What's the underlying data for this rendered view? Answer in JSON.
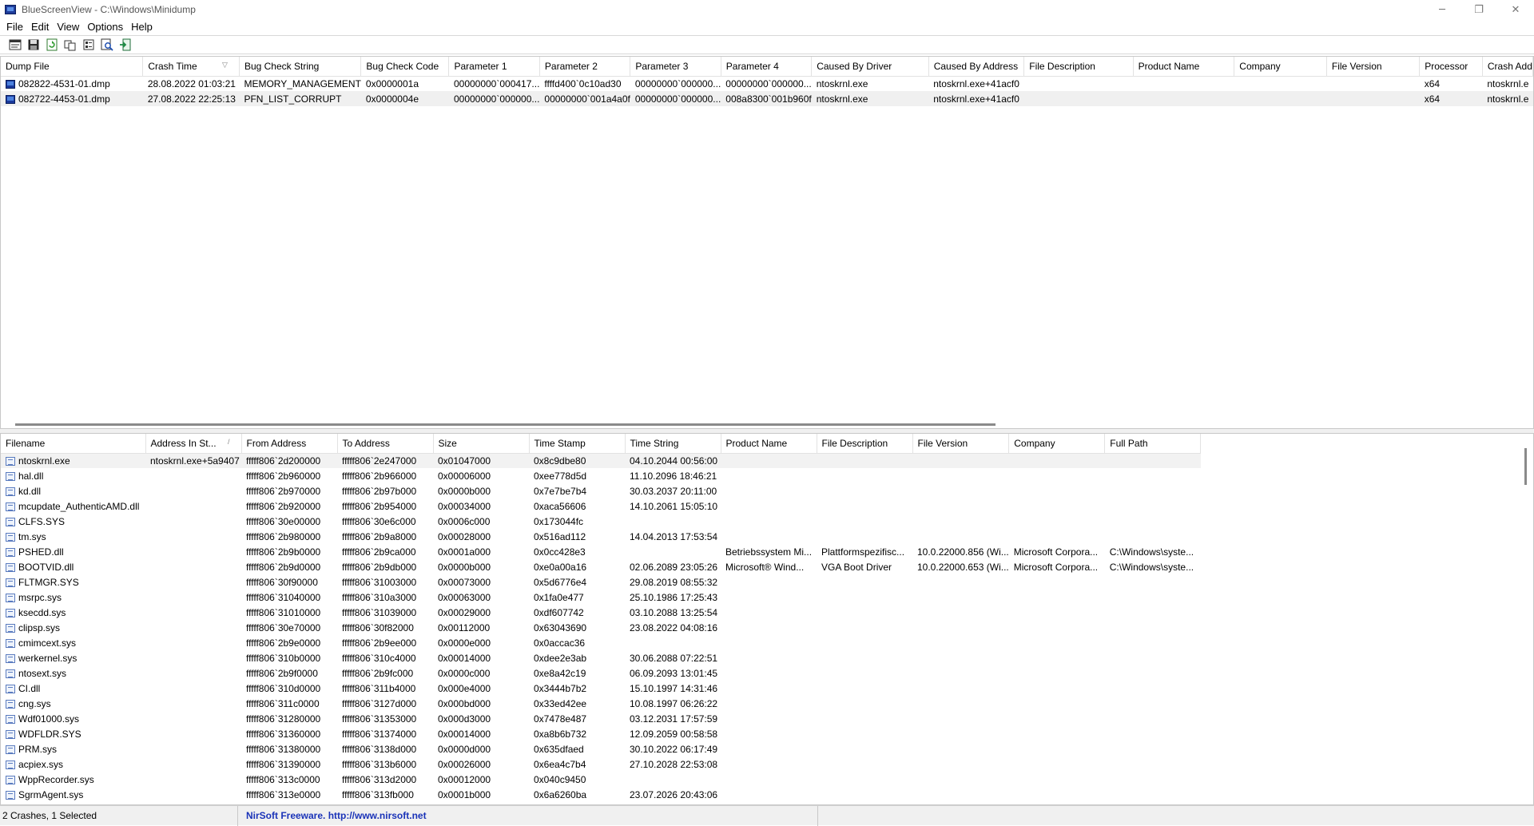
{
  "window": {
    "title": "BlueScreenView  -  C:\\Windows\\Minidump",
    "minimize_glyph": "─",
    "restore_glyph": "❐",
    "close_glyph": "✕"
  },
  "menu": [
    "File",
    "Edit",
    "View",
    "Options",
    "Help"
  ],
  "toolbar_icons": [
    "html-report-icon",
    "save-icon",
    "refresh-icon",
    "copy-icon",
    "properties-icon",
    "find-icon",
    "exit-icon"
  ],
  "crashes": {
    "columns": [
      {
        "label": "Dump File",
        "sort": ""
      },
      {
        "label": "Crash Time",
        "sort": "▽"
      },
      {
        "label": "Bug Check String",
        "sort": ""
      },
      {
        "label": "Bug Check Code",
        "sort": ""
      },
      {
        "label": "Parameter 1",
        "sort": ""
      },
      {
        "label": "Parameter 2",
        "sort": ""
      },
      {
        "label": "Parameter 3",
        "sort": ""
      },
      {
        "label": "Parameter 4",
        "sort": ""
      },
      {
        "label": "Caused By Driver",
        "sort": ""
      },
      {
        "label": "Caused By Address",
        "sort": ""
      },
      {
        "label": "File Description",
        "sort": ""
      },
      {
        "label": "Product Name",
        "sort": ""
      },
      {
        "label": "Company",
        "sort": ""
      },
      {
        "label": "File Version",
        "sort": ""
      },
      {
        "label": "Processor",
        "sort": ""
      },
      {
        "label": "Crash Add",
        "sort": ""
      }
    ],
    "rows": [
      [
        "082822-4531-01.dmp",
        "28.08.2022 01:03:21",
        "MEMORY_MANAGEMENT",
        "0x0000001a",
        "00000000`000417...",
        "ffffd400`0c10ad30",
        "00000000`000000...",
        "00000000`000000...",
        "ntoskrnl.exe",
        "ntoskrnl.exe+41acf0",
        "",
        "",
        "",
        "",
        "x64",
        "ntoskrnl.e"
      ],
      [
        "082722-4453-01.dmp",
        "27.08.2022 22:25:13",
        "PFN_LIST_CORRUPT",
        "0x0000004e",
        "00000000`000000...",
        "00000000`001a4a0f",
        "00000000`000000...",
        "008a8300`001b960f",
        "ntoskrnl.exe",
        "ntoskrnl.exe+41acf0",
        "",
        "",
        "",
        "",
        "x64",
        "ntoskrnl.e"
      ]
    ],
    "selected_index": 1
  },
  "modules": {
    "columns": [
      {
        "label": "Filename",
        "sort": ""
      },
      {
        "label": "Address In St...",
        "sort": "/"
      },
      {
        "label": "From Address",
        "sort": ""
      },
      {
        "label": "To Address",
        "sort": ""
      },
      {
        "label": "Size",
        "sort": ""
      },
      {
        "label": "Time Stamp",
        "sort": ""
      },
      {
        "label": "Time String",
        "sort": ""
      },
      {
        "label": "Product Name",
        "sort": ""
      },
      {
        "label": "File Description",
        "sort": ""
      },
      {
        "label": "File Version",
        "sort": ""
      },
      {
        "label": "Company",
        "sort": ""
      },
      {
        "label": "Full Path",
        "sort": ""
      }
    ],
    "rows": [
      [
        "ntoskrnl.exe",
        "ntoskrnl.exe+5a9407",
        "fffff806`2d200000",
        "fffff806`2e247000",
        "0x01047000",
        "0x8c9dbe80",
        "04.10.2044 00:56:00",
        "",
        "",
        "",
        "",
        ""
      ],
      [
        "hal.dll",
        "",
        "fffff806`2b960000",
        "fffff806`2b966000",
        "0x00006000",
        "0xee778d5d",
        "11.10.2096 18:46:21",
        "",
        "",
        "",
        "",
        ""
      ],
      [
        "kd.dll",
        "",
        "fffff806`2b970000",
        "fffff806`2b97b000",
        "0x0000b000",
        "0x7e7be7b4",
        "30.03.2037 20:11:00",
        "",
        "",
        "",
        "",
        ""
      ],
      [
        "mcupdate_AuthenticAMD.dll",
        "",
        "fffff806`2b920000",
        "fffff806`2b954000",
        "0x00034000",
        "0xaca56606",
        "14.10.2061 15:05:10",
        "",
        "",
        "",
        "",
        ""
      ],
      [
        "CLFS.SYS",
        "",
        "fffff806`30e00000",
        "fffff806`30e6c000",
        "0x0006c000",
        "0x173044fc",
        "",
        "",
        "",
        "",
        "",
        ""
      ],
      [
        "tm.sys",
        "",
        "fffff806`2b980000",
        "fffff806`2b9a8000",
        "0x00028000",
        "0x516ad112",
        "14.04.2013 17:53:54",
        "",
        "",
        "",
        "",
        ""
      ],
      [
        "PSHED.dll",
        "",
        "fffff806`2b9b0000",
        "fffff806`2b9ca000",
        "0x0001a000",
        "0x0cc428e3",
        "",
        "Betriebssystem Mi...",
        "Plattformspezifisc...",
        "10.0.22000.856 (Wi...",
        "Microsoft Corpora...",
        "C:\\Windows\\syste..."
      ],
      [
        "BOOTVID.dll",
        "",
        "fffff806`2b9d0000",
        "fffff806`2b9db000",
        "0x0000b000",
        "0xe0a00a16",
        "02.06.2089 23:05:26",
        "Microsoft® Wind...",
        "VGA Boot Driver",
        "10.0.22000.653 (Wi...",
        "Microsoft Corpora...",
        "C:\\Windows\\syste..."
      ],
      [
        "FLTMGR.SYS",
        "",
        "fffff806`30f90000",
        "fffff806`31003000",
        "0x00073000",
        "0x5d6776e4",
        "29.08.2019 08:55:32",
        "",
        "",
        "",
        "",
        ""
      ],
      [
        "msrpc.sys",
        "",
        "fffff806`31040000",
        "fffff806`310a3000",
        "0x00063000",
        "0x1fa0e477",
        "25.10.1986 17:25:43",
        "",
        "",
        "",
        "",
        ""
      ],
      [
        "ksecdd.sys",
        "",
        "fffff806`31010000",
        "fffff806`31039000",
        "0x00029000",
        "0xdf607742",
        "03.10.2088 13:25:54",
        "",
        "",
        "",
        "",
        ""
      ],
      [
        "clipsp.sys",
        "",
        "fffff806`30e70000",
        "fffff806`30f82000",
        "0x00112000",
        "0x63043690",
        "23.08.2022 04:08:16",
        "",
        "",
        "",
        "",
        ""
      ],
      [
        "cmimcext.sys",
        "",
        "fffff806`2b9e0000",
        "fffff806`2b9ee000",
        "0x0000e000",
        "0x0accac36",
        "",
        "",
        "",
        "",
        "",
        ""
      ],
      [
        "werkernel.sys",
        "",
        "fffff806`310b0000",
        "fffff806`310c4000",
        "0x00014000",
        "0xdee2e3ab",
        "30.06.2088 07:22:51",
        "",
        "",
        "",
        "",
        ""
      ],
      [
        "ntosext.sys",
        "",
        "fffff806`2b9f0000",
        "fffff806`2b9fc000",
        "0x0000c000",
        "0xe8a42c19",
        "06.09.2093 13:01:45",
        "",
        "",
        "",
        "",
        ""
      ],
      [
        "CI.dll",
        "",
        "fffff806`310d0000",
        "fffff806`311b4000",
        "0x000e4000",
        "0x3444b7b2",
        "15.10.1997 14:31:46",
        "",
        "",
        "",
        "",
        ""
      ],
      [
        "cng.sys",
        "",
        "fffff806`311c0000",
        "fffff806`3127d000",
        "0x000bd000",
        "0x33ed42ee",
        "10.08.1997 06:26:22",
        "",
        "",
        "",
        "",
        ""
      ],
      [
        "Wdf01000.sys",
        "",
        "fffff806`31280000",
        "fffff806`31353000",
        "0x000d3000",
        "0x7478e487",
        "03.12.2031 17:57:59",
        "",
        "",
        "",
        "",
        ""
      ],
      [
        "WDFLDR.SYS",
        "",
        "fffff806`31360000",
        "fffff806`31374000",
        "0x00014000",
        "0xa8b6b732",
        "12.09.2059 00:58:58",
        "",
        "",
        "",
        "",
        ""
      ],
      [
        "PRM.sys",
        "",
        "fffff806`31380000",
        "fffff806`3138d000",
        "0x0000d000",
        "0x635dfaed",
        "30.10.2022 06:17:49",
        "",
        "",
        "",
        "",
        ""
      ],
      [
        "acpiex.sys",
        "",
        "fffff806`31390000",
        "fffff806`313b6000",
        "0x00026000",
        "0x6ea4c7b4",
        "27.10.2028 22:53:08",
        "",
        "",
        "",
        "",
        ""
      ],
      [
        "WppRecorder.sys",
        "",
        "fffff806`313c0000",
        "fffff806`313d2000",
        "0x00012000",
        "0x040c9450",
        "",
        "",
        "",
        "",
        "",
        ""
      ],
      [
        "SgrmAgent.sys",
        "",
        "fffff806`313e0000",
        "fffff806`313fb000",
        "0x0001b000",
        "0x6a6260ba",
        "23.07.2026 20:43:06",
        "",
        "",
        "",
        "",
        ""
      ]
    ]
  },
  "status": {
    "left": "2 Crashes, 1 Selected",
    "middle": "NirSoft Freeware.  http://www.nirsoft.net"
  }
}
